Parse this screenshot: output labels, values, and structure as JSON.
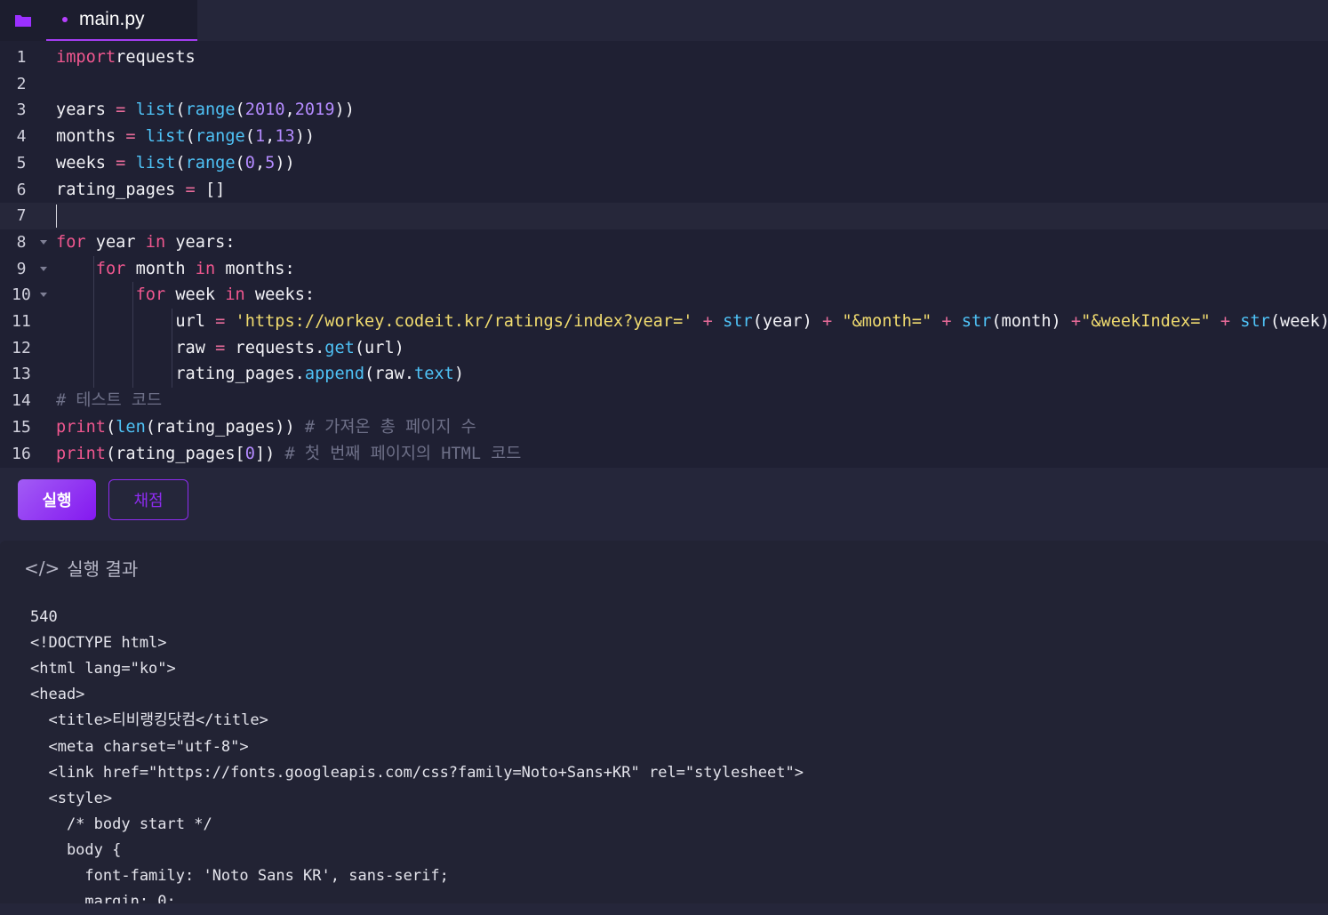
{
  "tab": {
    "filename": "main.py"
  },
  "editor": {
    "lines": [
      {
        "n": "1",
        "fold": false,
        "tokens": [
          [
            "kw",
            "import"
          ],
          [
            "",
            "requests"
          ]
        ]
      },
      {
        "n": "2",
        "fold": false,
        "tokens": []
      },
      {
        "n": "3",
        "fold": false,
        "tokens": [
          [
            "",
            "years"
          ],
          [
            "op",
            " = "
          ],
          [
            "fn",
            "list"
          ],
          [
            "",
            "("
          ],
          [
            "fn",
            "range"
          ],
          [
            "",
            "("
          ],
          [
            "num",
            "2010"
          ],
          [
            "",
            ","
          ],
          [
            "num",
            "2019"
          ],
          [
            "",
            "))"
          ]
        ]
      },
      {
        "n": "4",
        "fold": false,
        "tokens": [
          [
            "",
            "months"
          ],
          [
            "op",
            " = "
          ],
          [
            "fn",
            "list"
          ],
          [
            "",
            "("
          ],
          [
            "fn",
            "range"
          ],
          [
            "",
            "("
          ],
          [
            "num",
            "1"
          ],
          [
            "",
            ","
          ],
          [
            "num",
            "13"
          ],
          [
            "",
            "))"
          ]
        ]
      },
      {
        "n": "5",
        "fold": false,
        "tokens": [
          [
            "",
            "weeks"
          ],
          [
            "op",
            " = "
          ],
          [
            "fn",
            "list"
          ],
          [
            "",
            "("
          ],
          [
            "fn",
            "range"
          ],
          [
            "",
            "("
          ],
          [
            "num",
            "0"
          ],
          [
            "",
            ","
          ],
          [
            "num",
            "5"
          ],
          [
            "",
            "))"
          ]
        ]
      },
      {
        "n": "6",
        "fold": false,
        "tokens": [
          [
            "",
            "rating_pages"
          ],
          [
            "op",
            " = "
          ],
          [
            "",
            "[]"
          ]
        ]
      },
      {
        "n": "7",
        "fold": false,
        "tokens": [],
        "active": true
      },
      {
        "n": "8",
        "fold": true,
        "tokens": [
          [
            "kw",
            "for"
          ],
          [
            "",
            " year "
          ],
          [
            "kw",
            "in"
          ],
          [
            "",
            " years:"
          ]
        ]
      },
      {
        "n": "9",
        "fold": true,
        "tokens": [
          [
            "",
            "    "
          ],
          [
            "kw",
            "for"
          ],
          [
            "",
            " month "
          ],
          [
            "kw",
            "in"
          ],
          [
            "",
            " months:"
          ]
        ]
      },
      {
        "n": "10",
        "fold": true,
        "tokens": [
          [
            "",
            "        "
          ],
          [
            "kw",
            "for"
          ],
          [
            "",
            " week "
          ],
          [
            "kw",
            "in"
          ],
          [
            "",
            " weeks:"
          ]
        ]
      },
      {
        "n": "11",
        "fold": false,
        "tokens": [
          [
            "",
            "            url"
          ],
          [
            "op",
            " = "
          ],
          [
            "str",
            "'https://workey.codeit.kr/ratings/index?year='"
          ],
          [
            "op",
            " + "
          ],
          [
            "fn",
            "str"
          ],
          [
            "",
            "(year)"
          ],
          [
            "op",
            " + "
          ],
          [
            "str",
            "\"&month=\""
          ],
          [
            "op",
            " + "
          ],
          [
            "fn",
            "str"
          ],
          [
            "",
            "(month) "
          ],
          [
            "op",
            "+"
          ],
          [
            "str",
            "\"&weekIndex=\""
          ],
          [
            "op",
            " + "
          ],
          [
            "fn",
            "str"
          ],
          [
            "",
            "(week)"
          ]
        ]
      },
      {
        "n": "12",
        "fold": false,
        "tokens": [
          [
            "",
            "            raw"
          ],
          [
            "op",
            " = "
          ],
          [
            "",
            "requests."
          ],
          [
            "fn",
            "get"
          ],
          [
            "",
            "(url)"
          ]
        ]
      },
      {
        "n": "13",
        "fold": false,
        "tokens": [
          [
            "",
            "            rating_pages."
          ],
          [
            "fn",
            "append"
          ],
          [
            "",
            "(raw."
          ],
          [
            "fn",
            "text"
          ],
          [
            "",
            ")"
          ]
        ]
      },
      {
        "n": "14",
        "fold": false,
        "tokens": [
          [
            "cm",
            "# 테스트 코드"
          ]
        ]
      },
      {
        "n": "15",
        "fold": false,
        "tokens": [
          [
            "kw",
            "print"
          ],
          [
            "",
            "("
          ],
          [
            "fn",
            "len"
          ],
          [
            "",
            "(rating_pages)) "
          ],
          [
            "cm",
            "# 가져온 총 페이지 수"
          ]
        ]
      },
      {
        "n": "16",
        "fold": false,
        "tokens": [
          [
            "kw",
            "print"
          ],
          [
            "",
            "(rating_pages["
          ],
          [
            "num",
            "0"
          ],
          [
            "",
            "]) "
          ],
          [
            "cm",
            "# 첫 번째 페이지의 HTML 코드"
          ]
        ]
      }
    ]
  },
  "buttons": {
    "run": "실행",
    "grade": "채점"
  },
  "output": {
    "icon": "</>",
    "title": "실행 결과",
    "lines": [
      "540",
      "<!DOCTYPE html>",
      "<html lang=\"ko\">",
      "<head>",
      "  <title>티비랭킹닷컴</title>",
      "  <meta charset=\"utf-8\">",
      "  <link href=\"https://fonts.googleapis.com/css?family=Noto+Sans+KR\" rel=\"stylesheet\">",
      "  <style>",
      "    /* body start */",
      "    body {",
      "      font-family: 'Noto Sans KR', sans-serif;",
      "      margin: 0;"
    ]
  },
  "colors": {
    "accent": "#8e2cf0",
    "editor_bg": "#1f2033",
    "panel_bg": "#222334"
  }
}
